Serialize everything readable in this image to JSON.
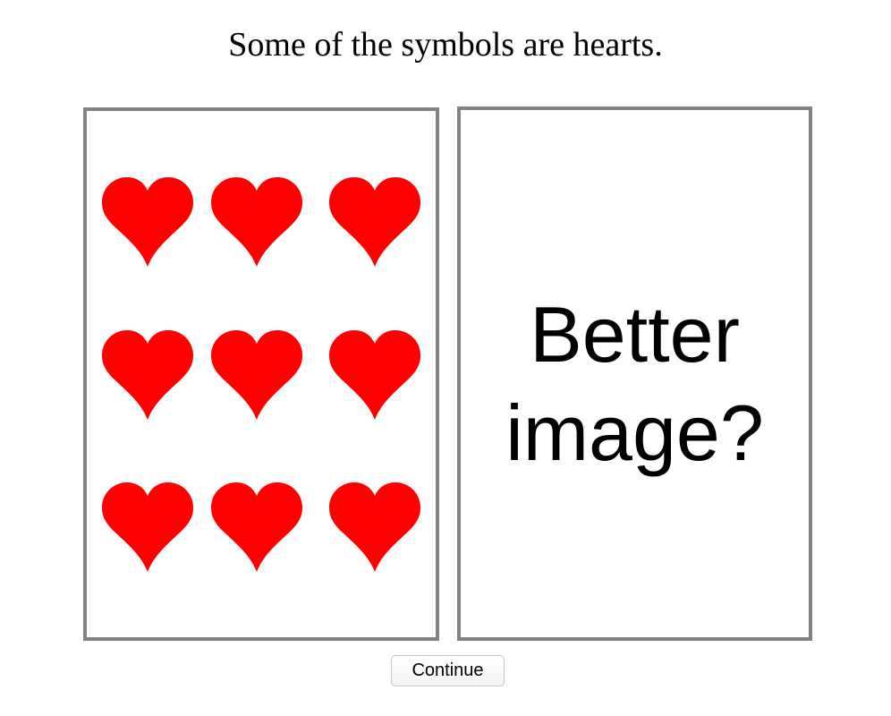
{
  "prompt": {
    "text": "Some of the symbols are hearts."
  },
  "left_card": {
    "symbol": "heart-icon",
    "symbol_color": "#ff0000",
    "symbol_count": 9
  },
  "right_card": {
    "text": "Better\nimage?"
  },
  "colors": {
    "card_border": "#808285",
    "heart": "#ff0000"
  },
  "continue_button": {
    "label": "Continue"
  }
}
